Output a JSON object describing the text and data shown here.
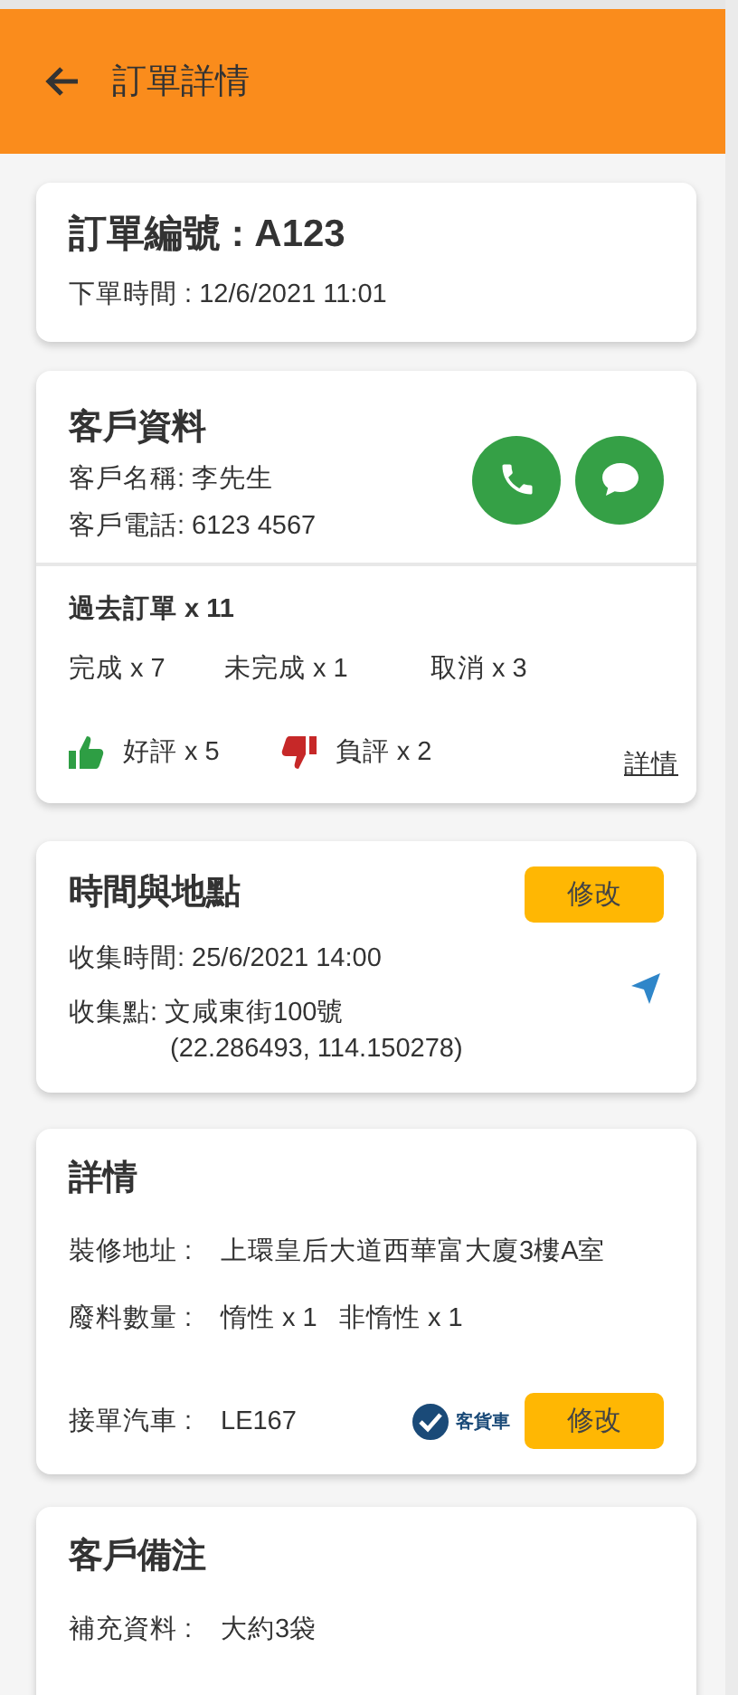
{
  "header": {
    "title": "訂單詳情"
  },
  "order": {
    "number": "訂單編號 : A123",
    "time": "下單時間 : 12/6/2021 11:01"
  },
  "customer": {
    "title": "客戶資料",
    "name": "客戶名稱: 李先生",
    "phone": "客戶電話: 6123 4567",
    "history": {
      "total": "過去訂單 x 11",
      "counts": [
        "完成 x 7",
        "未完成 x 1",
        "取消 x 3"
      ],
      "good": "好評 x 5",
      "bad": "負評 x 2",
      "link": "詳情"
    }
  },
  "time_place": {
    "title": "時間與地點",
    "edit": "修改",
    "time": "收集時間: 25/6/2021  14:00",
    "place": "收集點: 文咸東街100號",
    "coords": "(22.286493, 114.150278)"
  },
  "details": {
    "title": "詳情",
    "rows": [
      {
        "label": "裝修地址 :",
        "value": "上環皇后大道西華富大廈3樓A室"
      },
      {
        "label": "廢料數量 :",
        "value": "惰性 x 1   非惰性 x 1"
      }
    ],
    "vehicle": {
      "label": "接單汽車 :",
      "value": "LE167",
      "option": "客貨車",
      "checked": true
    },
    "edit": "修改"
  },
  "notes": {
    "title": "客戶備注",
    "rows": [
      {
        "label": "補充資料 :",
        "value": "大約3袋"
      }
    ]
  }
}
